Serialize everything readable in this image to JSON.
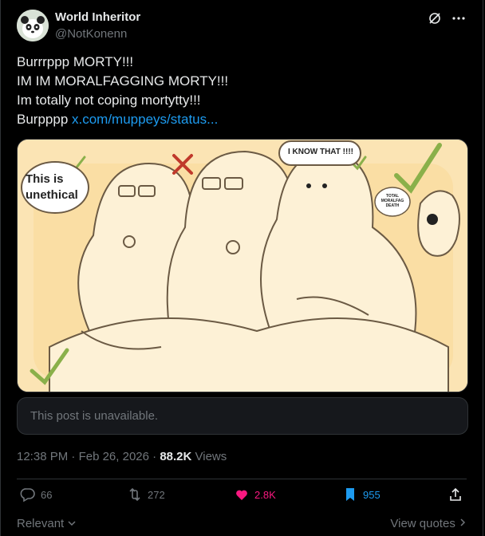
{
  "author": {
    "name": "World Inheritor",
    "handle": "@NotKonenn"
  },
  "header_icons": [
    "grok-slash-icon",
    "more-icon"
  ],
  "post": {
    "lines": [
      "Burrrppp MORTY!!!",
      "IM IM MORALFAGGING MORTY!!!",
      "Im totally not coping mortytty!!!"
    ],
    "last_line_prefix": "Burpppp ",
    "link_text": "x.com/muppeys/status..."
  },
  "media": {
    "bubble_left": "This is\nunethical",
    "bubble_top": "I KNOW THAT !!!!",
    "bubble_small": "TOTAL\nMORALFAG\nDEATH",
    "colors": {
      "bg": "#fbe4b4",
      "line": "#6b5a44",
      "check": "#8ab04a",
      "cross": "#c0392b"
    }
  },
  "quote": {
    "text": "This post is unavailable."
  },
  "meta": {
    "time": "12:38 PM",
    "date": "Feb 26, 2026",
    "views_count": "88.2K",
    "views_label": "Views"
  },
  "actions": {
    "replies": "66",
    "reposts": "272",
    "likes": "2.8K",
    "bookmarks": "955"
  },
  "footer": {
    "relevant": "Relevant",
    "view_quotes": "View quotes"
  },
  "colors": {
    "accent": "#1d9bf0",
    "like": "#f91880",
    "muted": "#71767b"
  }
}
